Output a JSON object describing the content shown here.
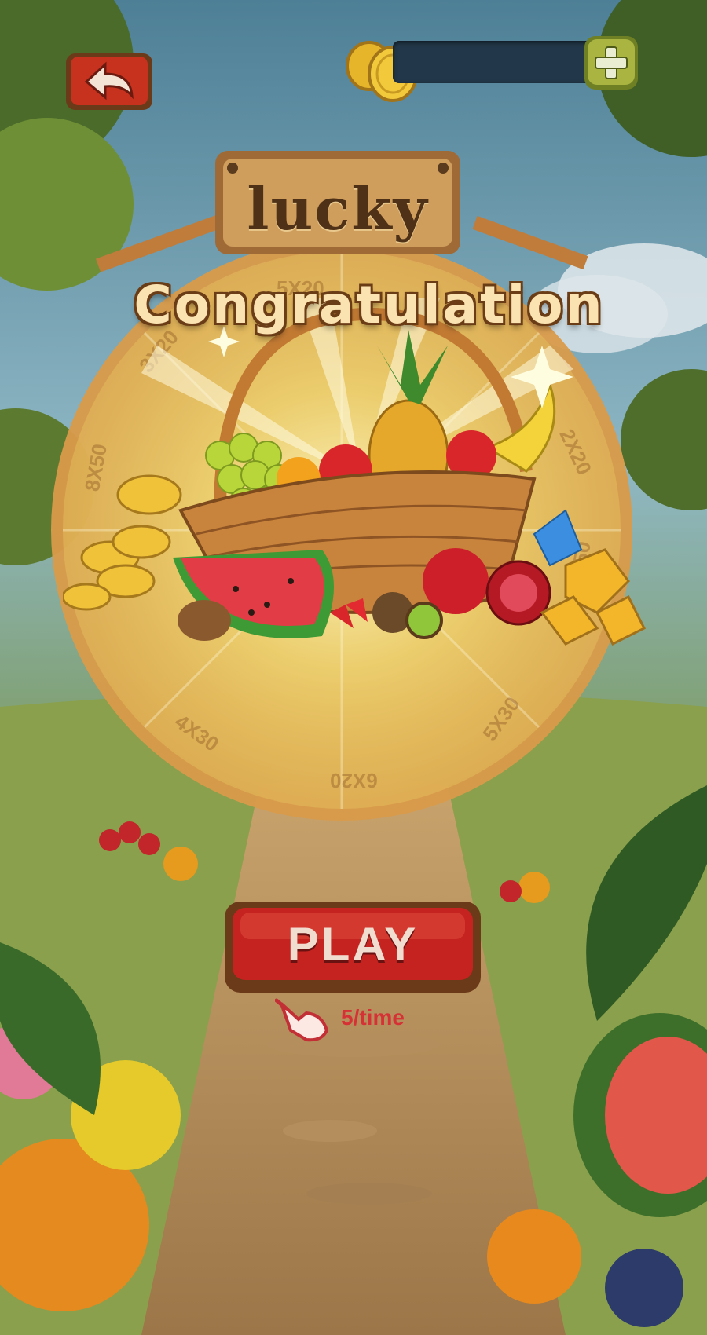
{
  "game": {
    "title": "lucky",
    "banner": "Congratulation",
    "coins": "",
    "wheel_segments": [
      "5X20",
      "3X20",
      "8X50",
      "4X30",
      "6X20",
      "5X30",
      "4X50",
      "2X20"
    ],
    "play_button": "PLAY",
    "cost": "5/time"
  },
  "icons": {
    "back": "back-arrow-icon",
    "add": "plus-icon",
    "coin": "coin-icon",
    "hand": "pointing-hand-icon"
  },
  "colors": {
    "button_red": "#c4231f",
    "wood": "#8b4e25",
    "banner_text": "#fbe3b1",
    "cost_text": "#d63236"
  }
}
